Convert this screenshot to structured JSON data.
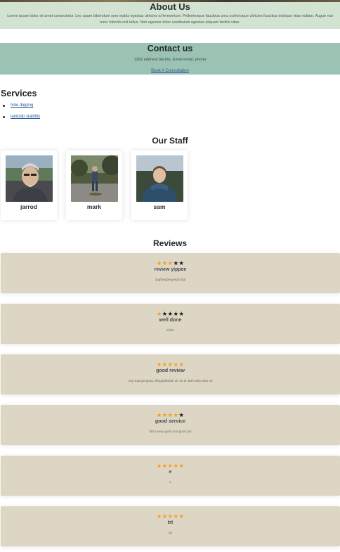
{
  "about": {
    "title": "About Us",
    "text": "Lorem ipsum dolor sit amet consectetur. Leo quam bibendum sem mattis egestas ultricies id fermentum. Pellentesque faucibus urna scelerisque ultricies faucibus tristique vitae nullam. Augue nisi nunc lobortis nisl tellus. Non egestas dolor vestibulum egestas eliquam facilisi vitae."
  },
  "contact": {
    "title": "Contact us",
    "address": "1282 address bla bla, Email email, phone",
    "link_label": "Book A Consultation"
  },
  "services": {
    "title": "Services",
    "items": [
      "hole digging",
      "landslip stability"
    ]
  },
  "staff": {
    "title": "Our Staff",
    "members": [
      {
        "name": "jarrod"
      },
      {
        "name": "mark"
      },
      {
        "name": "sam"
      }
    ]
  },
  "reviews": {
    "title": "Reviews",
    "items": [
      {
        "rating": 3,
        "out_of": 5,
        "title": "review yippee",
        "text": "3ugheigbergergv43gr"
      },
      {
        "rating": 1,
        "out_of": 5,
        "title": "well done",
        "text": "efefw"
      },
      {
        "rating": 5,
        "out_of": 5,
        "title": "good review",
        "text": "reg regergerg34g 4f8rg35th35th 3h 35 th 35th 35th 35th 35"
      },
      {
        "rating": 4,
        "out_of": 5,
        "title": "good service",
        "text": "did a very quick and good job"
      },
      {
        "rating": 5,
        "out_of": 5,
        "title": "e",
        "text": "e"
      },
      {
        "rating": 5,
        "out_of": 5,
        "title": "trt",
        "text": "rgr"
      }
    ]
  },
  "colors": {
    "about_bg": "#d3e3d1",
    "contact_bg": "#9cc2b4",
    "review_bg": "#ddd6c4",
    "star_filled": "#f0a321",
    "star_empty": "#1a1a1a",
    "link": "#2a5d9a"
  },
  "icons": {
    "star_filled": "star-filled-icon",
    "star_empty": "star-empty-icon",
    "bullet": "bullet-icon"
  }
}
